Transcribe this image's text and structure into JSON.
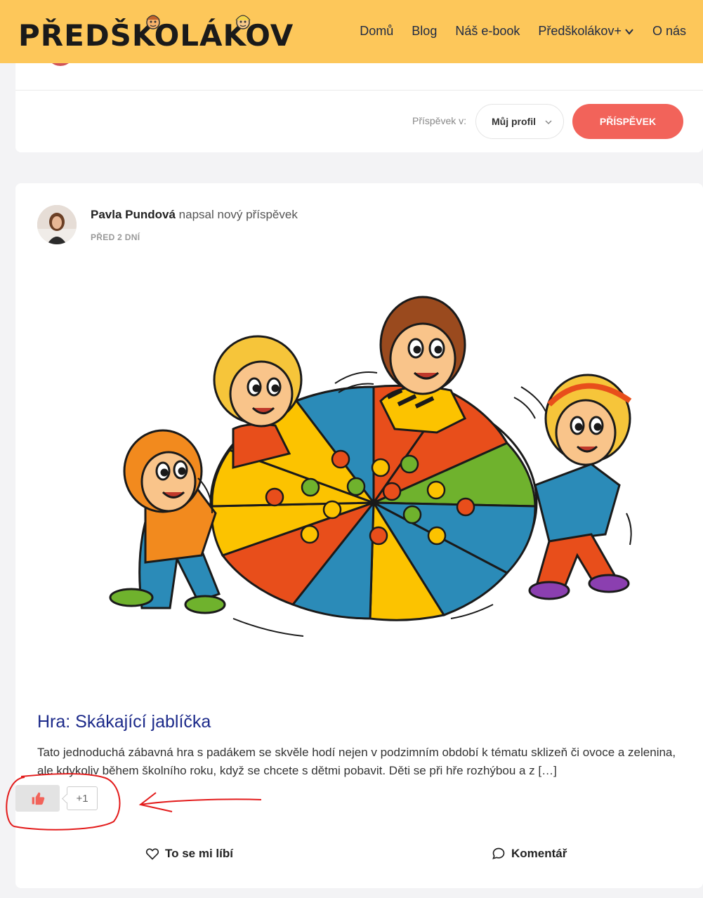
{
  "header": {
    "logo_text": "PŘEDŠKOLÁKOV",
    "nav": [
      "Domů",
      "Blog",
      "Náš e-book",
      "Předškolákov+",
      "O nás"
    ],
    "colors": {
      "header_bg": "#fdc75a",
      "accent": "#f2635a",
      "title_link": "#1c2a8a"
    }
  },
  "composer": {
    "post_in_label": "Příspěvek v:",
    "post_in_value": "Můj profil",
    "submit_label": "PŘÍSPĚVEK"
  },
  "post": {
    "author": "Pavla Pundová",
    "action_text": "napsal nový příspěvek",
    "time": "PŘED 2 DNÍ",
    "title": "Hra: Skákající jablíčka",
    "excerpt": "Tato jednoduchá zábavná hra s padákem se skvěle hodí nejen v podzimním období k tématu sklizeň či ovoce a zelenina, ale kdykoliv během školního roku, když se chcete s dětmi pobavit. Děti se při hře rozhýbou a z […]",
    "like_count": "+1",
    "like_label": "To se mi líbí",
    "comment_label": "Komentář"
  },
  "icons": {
    "thumb": "thumbs-up-icon",
    "heart": "heart-icon",
    "comment": "comment-bubble-icon",
    "chevron": "chevron-down-icon"
  }
}
